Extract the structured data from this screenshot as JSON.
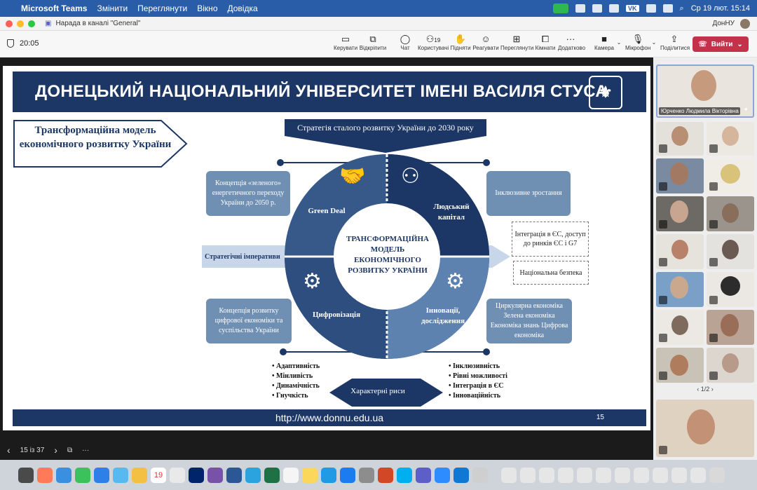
{
  "menubar": {
    "app": "Microsoft Teams",
    "items": [
      "Змінити",
      "Переглянути",
      "Вікно",
      "Довідка"
    ],
    "vk": "VK",
    "date_time": "Ср 19 лют.  15:14"
  },
  "window": {
    "title": "Нарада в каналі \"General\"",
    "org": "ДонНУ"
  },
  "toolbar": {
    "timer": "20:05",
    "buttons": [
      {
        "label": "Керувати",
        "icon": "manage-icon"
      },
      {
        "label": "Відкріпити",
        "icon": "unpin-icon"
      },
      {
        "label": "Чат",
        "icon": "chat-icon"
      },
      {
        "label": "Користувачі",
        "icon": "people-icon",
        "count": "19"
      },
      {
        "label": "Підняти",
        "icon": "hand-icon"
      },
      {
        "label": "Реагувати",
        "icon": "emoji-icon"
      },
      {
        "label": "Переглянути",
        "icon": "view-icon"
      },
      {
        "label": "Кімнати",
        "icon": "rooms-icon"
      },
      {
        "label": "Додатково",
        "icon": "more-icon"
      },
      {
        "label": "Камера",
        "icon": "camera-icon"
      },
      {
        "label": "Мікрофон",
        "icon": "mic-off-icon"
      },
      {
        "label": "Поділитися",
        "icon": "share-icon"
      }
    ],
    "leave": "Вийти"
  },
  "slide": {
    "header": "ДОНЕЦЬКИЙ НАЦІОНАЛЬНИЙ УНІВЕРСИТЕТ ІМЕНІ ВАСИЛЯ СТУСА",
    "model_title": "Трансформаційна модель економічного розвитку України",
    "strategy": "Стратегія сталого розвитку України до 2030 року",
    "left_top": "Концепція «зеленого» енергетичного переходу України до 2050 р.",
    "left_bottom": "Концепція розвитку цифрової економіки та суспільства України",
    "right_top": "Інклюзивне зростання",
    "right_box1": "Інтеграція в ЄС, доступ до ринків ЄС і G7",
    "right_box2": "Національна безпека",
    "right_bottom": "Циркулярна економіка Зелена економіка Економіка знань Цифрова економіка",
    "imperatives": "Стратегічні імперативи",
    "seg_green": "Green Deal",
    "seg_human": "Людський капітал",
    "seg_digital": "Цифровізація",
    "seg_innov": "Інновації, дослідження",
    "center": "ТРАНСФОРМАЦІЙНА МОДЕЛЬ ЕКОНОМІЧНОГО РОЗВИТКУ УКРАЇНИ",
    "features_label": "Характерні риси",
    "features_left": [
      "Адаптивність",
      "Мінливість",
      "Динамічність",
      "Гнучкість"
    ],
    "features_right": [
      "Інклюзивність",
      "Рівні можливості",
      "Інтеграція в ЄС",
      "Інноваційність"
    ],
    "url": "http://www.donnu.edu.ua",
    "page": "15"
  },
  "slide_nav": {
    "counter": "15 із 37"
  },
  "participants": {
    "featured_name": "Юрченко Людмила Вікторівна",
    "pager": "1/2"
  },
  "dock": {
    "calendar_day": "19"
  },
  "colors": {
    "navy": "#1c3766",
    "ring": "#36598a",
    "leave": "#c4314b"
  }
}
